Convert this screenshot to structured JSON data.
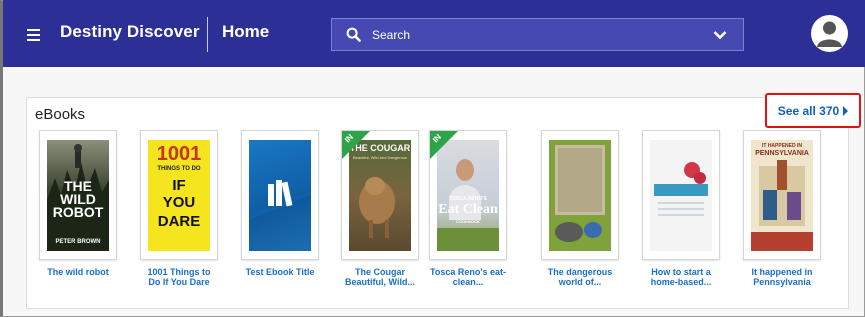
{
  "header": {
    "app_title": "Destiny Discover",
    "nav_home": "Home",
    "search_placeholder": "Search"
  },
  "ebooks": {
    "section_title": "eBooks",
    "see_all_label": "See all 370",
    "items": [
      {
        "title_line1": "The wild robot",
        "title_line2": "",
        "cover_text_1": "THE",
        "cover_text_2": "WILD",
        "cover_text_3": "ROBOT",
        "cover_text_4": "PETER BROWN"
      },
      {
        "title_line1": "1001 Things to",
        "title_line2": "Do If You Dare",
        "cover_text_1": "1001",
        "cover_text_2": "THINGS TO DO",
        "cover_text_3": "IF",
        "cover_text_4": "YOU",
        "cover_text_5": "DARE"
      },
      {
        "title_line1": "Test Ebook Title",
        "title_line2": ""
      },
      {
        "title_line1": "The Cougar",
        "title_line2": "Beautiful, Wild...",
        "ribbon": "IN",
        "cover_text_1": "THE COUGAR",
        "cover_text_2": "Beautiful, Wild and Dangerous"
      },
      {
        "title_line1": "Tosca Reno's eat-",
        "title_line2": "clean...",
        "ribbon": "IN",
        "cover_text_1": "TOSCA RENO'S",
        "cover_text_2": "Eat Clean",
        "cover_text_3": "COOKBOOK"
      },
      {
        "title_line1": "The dangerous",
        "title_line2": "world of..."
      },
      {
        "title_line1": "How to start a",
        "title_line2": "home-based..."
      },
      {
        "title_line1": "It happened in",
        "title_line2": "Pennsylvania",
        "cover_text_1": "IT HAPPENED IN",
        "cover_text_2": "PENNSYLVANIA"
      }
    ]
  },
  "colors": {
    "topbar": "#2b2f96",
    "link": "#1a6fc8",
    "highlight_border": "#e01212",
    "ribbon": "#2da44a"
  }
}
